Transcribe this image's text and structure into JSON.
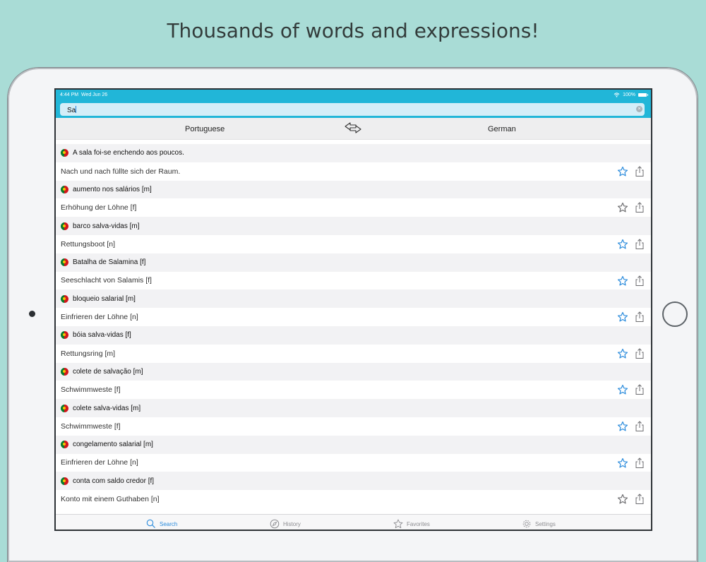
{
  "headline": "Thousands of words and expressions!",
  "status": {
    "time": "4:44 PM",
    "date": "Wed Jun 26",
    "battery": "100%"
  },
  "search": {
    "value": "Sa"
  },
  "languages": {
    "source": "Portuguese",
    "target": "German"
  },
  "entries": [
    {
      "source": "A sala foi-se enchendo aos poucos.",
      "target": "Nach und nach füllte sich der Raum.",
      "favorite": true
    },
    {
      "source": "aumento nos salários [m]",
      "target": "Erhöhung der Löhne [f]",
      "favorite": false
    },
    {
      "source": "barco salva-vidas [m]",
      "target": "Rettungsboot [n]",
      "favorite": true
    },
    {
      "source": "Batalha de Salamina [f]",
      "target": "Seeschlacht von Salamis [f]",
      "favorite": true
    },
    {
      "source": "bloqueio salarial [m]",
      "target": "Einfrieren der Löhne [n]",
      "favorite": true
    },
    {
      "source": "bóia salva-vidas [f]",
      "target": "Rettungsring [m]",
      "favorite": true
    },
    {
      "source": "colete de salvação [m]",
      "target": "Schwimmweste [f]",
      "favorite": true
    },
    {
      "source": "colete salva-vidas [m]",
      "target": "Schwimmweste [f]",
      "favorite": true
    },
    {
      "source": "congelamento salarial [m]",
      "target": "Einfrieren der Löhne [n]",
      "favorite": true
    },
    {
      "source": "conta com saldo credor [f]",
      "target": "Konto mit einem Guthaben [n]",
      "favorite": false
    }
  ],
  "tabs": [
    {
      "label": "Search",
      "icon": "search-icon",
      "active": true
    },
    {
      "label": "History",
      "icon": "compass-icon",
      "active": false
    },
    {
      "label": "Favorites",
      "icon": "star-icon",
      "active": false
    },
    {
      "label": "Settings",
      "icon": "gear-icon",
      "active": false
    }
  ],
  "colors": {
    "accent": "#21b6d8",
    "background": "#a9dcd6",
    "favorite": "#2a8bdc",
    "tab_active": "#2a8bdc"
  }
}
